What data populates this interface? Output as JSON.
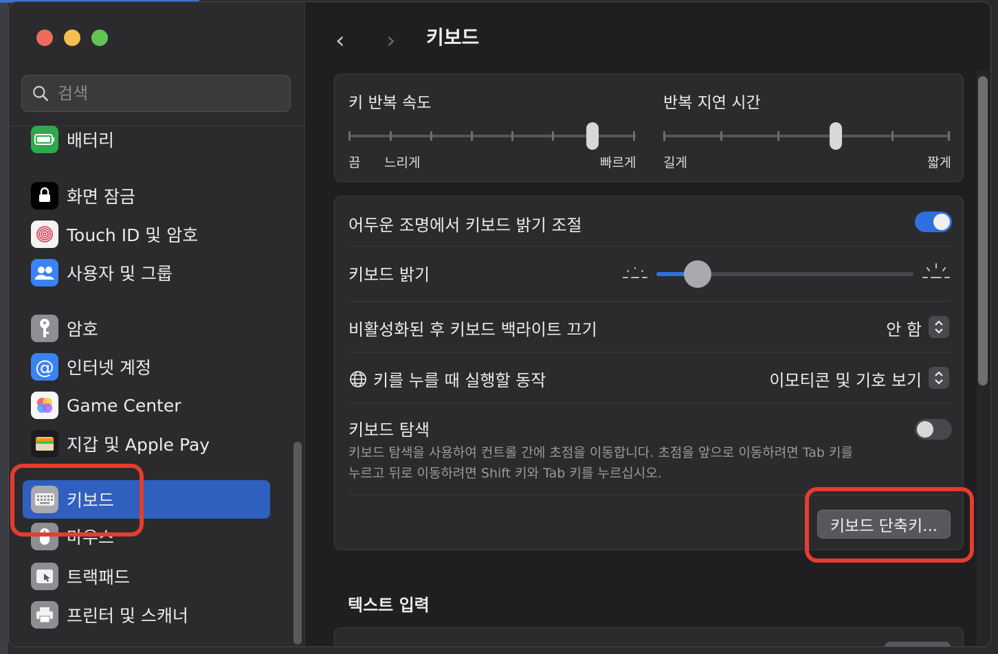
{
  "window_title": "키보드",
  "search": {
    "placeholder": "검색"
  },
  "sidebar": {
    "items": [
      {
        "label": "배터리",
        "icon": "battery-icon",
        "color": "#34c759"
      },
      {
        "label": "화면 잠금",
        "icon": "lock-icon",
        "color": "#000000"
      },
      {
        "label": "Touch ID 및 암호",
        "icon": "fingerprint-icon",
        "color": "#ffffff"
      },
      {
        "label": "사용자 및 그룹",
        "icon": "users-icon",
        "color": "#3a82f7"
      },
      {
        "label": "암호",
        "icon": "key-icon",
        "color": "#8e8e93"
      },
      {
        "label": "인터넷 계정",
        "icon": "at-icon",
        "color": "#3a82f7"
      },
      {
        "label": "Game Center",
        "icon": "game-center-icon",
        "color": "#ffffff"
      },
      {
        "label": "지갑 및 Apple Pay",
        "icon": "wallet-icon",
        "color": "#2c2c2e"
      },
      {
        "label": "키보드",
        "icon": "keyboard-icon",
        "color": "#8e8e93",
        "selected": true
      },
      {
        "label": "마우스",
        "icon": "mouse-icon",
        "color": "#8e8e93"
      },
      {
        "label": "트랙패드",
        "icon": "trackpad-icon",
        "color": "#8e8e93"
      },
      {
        "label": "프린터 및 스캐너",
        "icon": "printer-icon",
        "color": "#8e8e93"
      }
    ]
  },
  "key_repeat": {
    "title": "키 반복 속도",
    "labels": {
      "off": "끔",
      "slow": "느리게",
      "fast": "빠르게"
    },
    "value_fraction": 0.85
  },
  "repeat_delay": {
    "title": "반복 지연 시간",
    "labels": {
      "long": "길게",
      "short": "짧게"
    },
    "value_fraction": 0.6
  },
  "settings": {
    "auto_brightness": {
      "label": "어두운 조명에서 키보드 밝기 조절",
      "on": true
    },
    "brightness": {
      "label": "키보드 밝기",
      "value_fraction": 0.16
    },
    "backlight_off": {
      "label": "비활성화된 후 키보드 백라이트 끄기",
      "value": "안 함"
    },
    "globe_key": {
      "label": "키를 누를 때 실행할 동작",
      "value": "이모티콘 및 기호 보기"
    },
    "keyboard_nav": {
      "label": "키보드 탐색",
      "description_line1": "키보드 탐색을 사용하여 컨트롤 간에 초점을 이동합니다. 초점을 앞으로 이동하려면 Tab 키를",
      "description_line2": "누르고 뒤로 이동하려면 Shift 키와 Tab 키를 누르십시오.",
      "on": false
    },
    "shortcuts_button": "키보드 단축키..."
  },
  "text_input": {
    "section_title": "텍스트 입력"
  },
  "colors": {
    "accent": "#2f5fbf",
    "highlight": "#e63c2f",
    "toggle_on": "#2f6fdf"
  }
}
